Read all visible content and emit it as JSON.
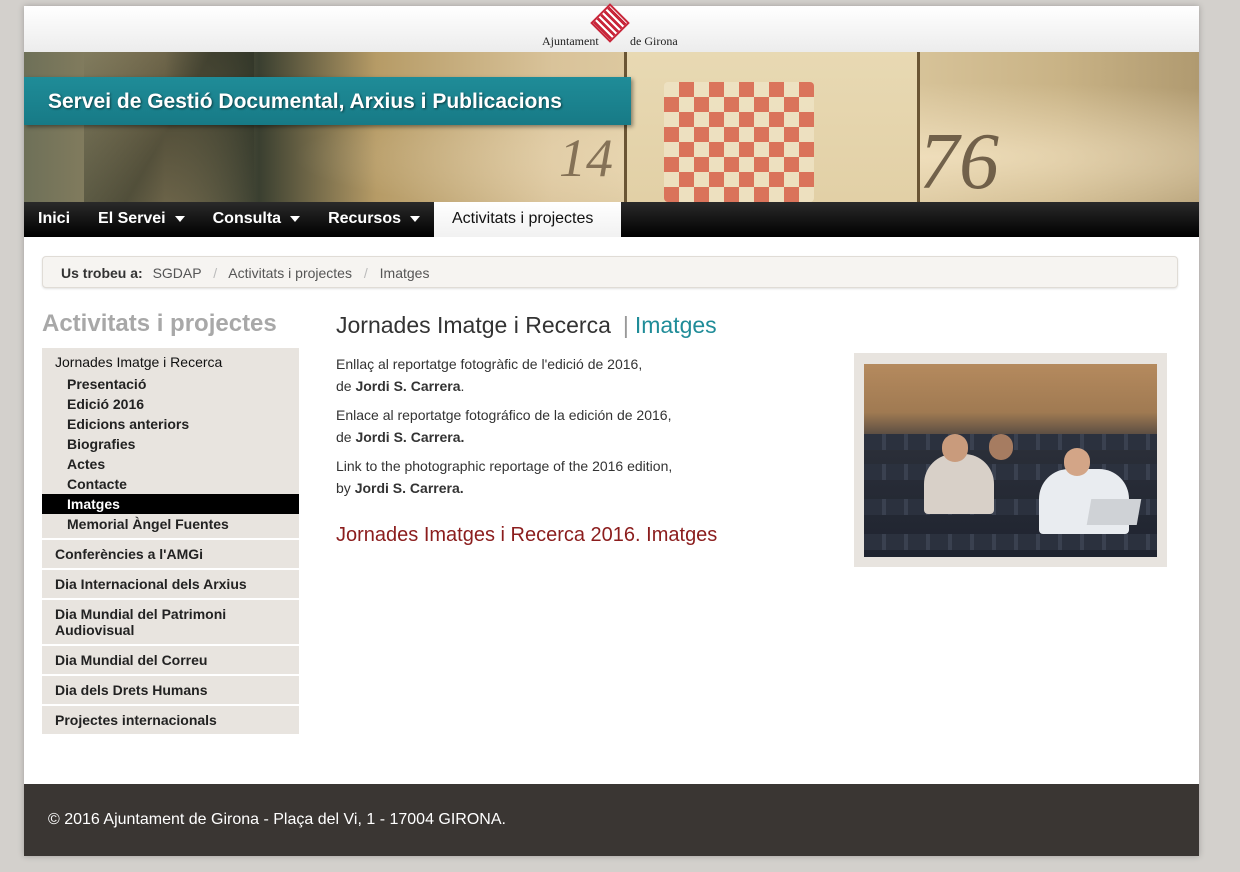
{
  "logo": {
    "left_text": "Ajuntament",
    "right_text": "de Girona"
  },
  "banner": {
    "title": "Servei de Gestió Documental, Arxius i Publicacions",
    "num_left": "14",
    "num_right": "76"
  },
  "nav": {
    "items": [
      {
        "label": "Inici",
        "caret": false
      },
      {
        "label": "El Servei",
        "caret": true
      },
      {
        "label": "Consulta",
        "caret": true
      },
      {
        "label": "Recursos",
        "caret": true
      },
      {
        "label": "Activitats i projectes",
        "caret": false,
        "active": true
      }
    ]
  },
  "breadcrumb": {
    "label": "Us trobeu a:",
    "items": [
      "SGDAP",
      "Activitats i projectes",
      "Imatges"
    ]
  },
  "sidebar": {
    "title": "Activitats i projectes",
    "group_main": "Jornades Imatge i Recerca",
    "sub_items": [
      "Presentació",
      "Edició 2016",
      "Edicions anteriors",
      "Biografies",
      "Actes",
      "Contacte",
      "Imatges",
      "Memorial Àngel Fuentes"
    ],
    "active_sub": "Imatges",
    "groups": [
      "Conferències a l'AMGi",
      "Dia Internacional dels Arxius",
      "Dia Mundial del Patrimoni Audiovisual",
      "Dia Mundial del Correu",
      "Dia dels Drets Humans",
      "Projectes internacionals"
    ]
  },
  "content": {
    "title": "Jornades Imatge i Recerca",
    "separator": "|",
    "subtitle": "Imatges",
    "paragraphs": [
      {
        "line1": "Enllaç al reportatge fotogràfic de l'edició de 2016,",
        "prefix": "de ",
        "author": "Jordi S. Carrera",
        "suffix": "."
      },
      {
        "line1": "Enlace al reportatge fotográfico de la edición de 2016,",
        "prefix": "de ",
        "author": "Jordi S. Carrera.",
        "suffix": ""
      },
      {
        "line1": "Link to the photographic reportage of the 2016 edition,",
        "prefix": "by ",
        "author": "Jordi S. Carrera.",
        "suffix": ""
      }
    ],
    "album_link": "Jornades Imatges i Recerca 2016. Imatges"
  },
  "footer": {
    "text": "© 2016 Ajuntament de Girona - Plaça del Vi, 1 - 17004 GIRONA."
  }
}
